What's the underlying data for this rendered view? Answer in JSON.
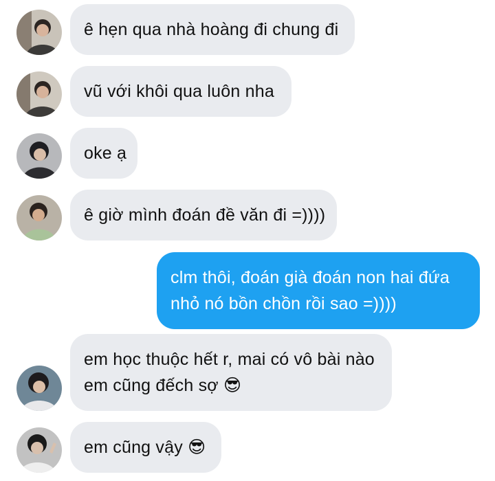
{
  "colors": {
    "incoming_bubble": "#e9ebef",
    "outgoing_bubble": "#1ea1f1",
    "incoming_text": "#111111",
    "outgoing_text": "#ffffff"
  },
  "messages": [
    {
      "direction": "incoming",
      "avatar": "user-avatar",
      "lines": [
        "ê hẹn qua nhà hoàng đi chung đi"
      ]
    },
    {
      "direction": "incoming",
      "avatar": "user-avatar",
      "lines": [
        "vũ với khôi qua luôn nha"
      ]
    },
    {
      "direction": "incoming",
      "avatar": "user-avatar",
      "lines": [
        "oke ạ"
      ]
    },
    {
      "direction": "incoming",
      "avatar": "user-avatar",
      "lines": [
        "ê giờ mình đoán đề văn đi =))))"
      ]
    },
    {
      "direction": "outgoing",
      "lines": [
        "clm thôi, đoán già đoán non hai đứa",
        "nhỏ nó bồn chồn rồi sao =))))"
      ]
    },
    {
      "direction": "incoming",
      "avatar": "user-avatar",
      "lines": [
        "em học thuộc hết r, mai có vô bài nào",
        "em cũng đếch sợ"
      ],
      "emoji": "😎"
    },
    {
      "direction": "incoming",
      "avatar": "user-avatar",
      "lines": [
        "em cũng vậy"
      ],
      "emoji": "😎"
    }
  ]
}
